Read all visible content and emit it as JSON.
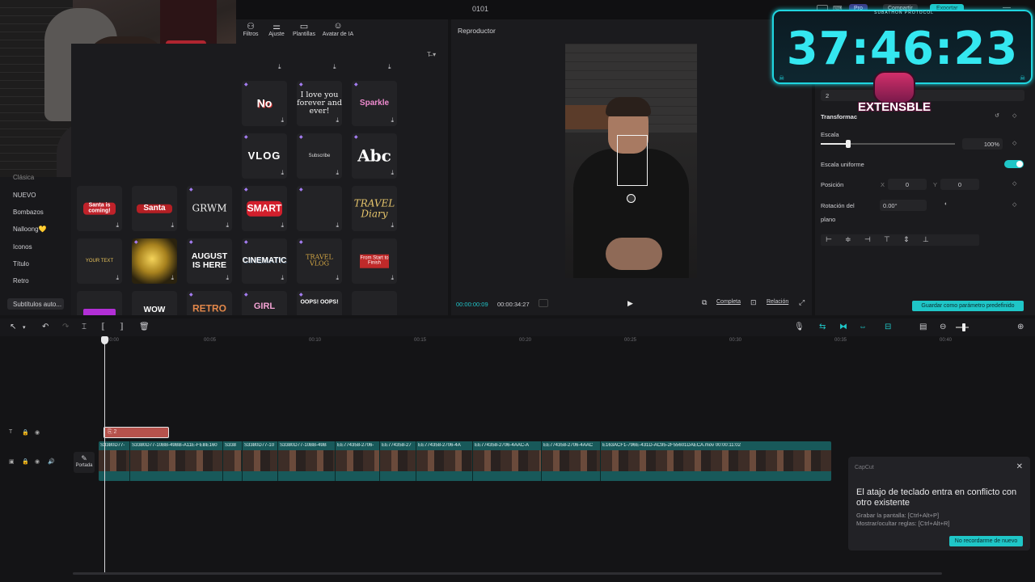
{
  "window": {
    "title": "0101"
  },
  "media_tabs": [
    {
      "label": "Filtros",
      "icon": "filter-icon"
    },
    {
      "label": "Ajuste",
      "icon": "sliders-icon"
    },
    {
      "label": "Plantillas",
      "icon": "template-icon"
    },
    {
      "label": "Avatar de IA",
      "icon": "avatar-icon"
    }
  ],
  "categories": [
    {
      "label": "Clásica"
    },
    {
      "label": "NUEVO"
    },
    {
      "label": "Bombazos"
    },
    {
      "label": "Nalloong💛"
    },
    {
      "label": "Iconos"
    },
    {
      "label": "Título"
    },
    {
      "label": "Retro"
    },
    {
      "label": "Subtítulos auto..."
    }
  ],
  "stickers": {
    "row1": [
      "No",
      "I love you forever and ever!",
      "Sparkle"
    ],
    "row2": [
      "VLOG",
      "Subscribe",
      "Abc"
    ],
    "row3": [
      "Santa is coming!",
      "Santa",
      "GRWM",
      "SMART",
      "",
      "TRAVEL Diary"
    ],
    "row4": [
      "YOUR TEXT",
      "",
      "AUGUST IS HERE",
      "CINEMATIC",
      "TRAVEL VLOG",
      "From Start to Finish"
    ],
    "row5": [
      "",
      "WOW",
      "RETRO",
      "GIRL",
      "OOPS! OOPS!",
      ""
    ]
  },
  "player": {
    "title": "Reproductor",
    "current_time": "00:00:00:09",
    "total_time": "00:00:34:27",
    "full_label": "Completa",
    "ratio_label": "Relación"
  },
  "props": {
    "top_value": "2",
    "transform_label": "Transformac",
    "scale_label": "Escala",
    "scale_value": "100%",
    "scale_fraction": 0.2,
    "uniform_scale_label": "Escala uniforme",
    "uniform_scale_on": true,
    "position_label": "Posición",
    "pos_x_axis": "X",
    "pos_x": "0",
    "pos_y_axis": "Y",
    "pos_y": "0",
    "rotation_label_1": "Rotación del",
    "rotation_label_2": "plano",
    "rotation_value": "0.00°",
    "save_button": "Guardar como parámetro predefinido"
  },
  "top_header": {
    "pro_label": "Pro",
    "share_label": "Compartir",
    "export_label": "Exportar"
  },
  "timer": {
    "subtitle": "SUBATHON PROTOCOL",
    "value": "37:46:23",
    "badge": "EXTENSBLE"
  },
  "timeline": {
    "ruler": [
      "00:00",
      "00:05",
      "00:10",
      "00:15",
      "00:20",
      "00:25",
      "00:30",
      "00:35",
      "00:40"
    ],
    "text_clip": "2",
    "portada_label": "Portada",
    "clips": [
      "S3380D77-",
      "S3380D77-10BB-49BB-A11E-FEBE160",
      "S338",
      "S3380D77-10",
      "S3380D77-10BB-49B",
      "EE774358-2706-",
      "EE774358-27",
      "EE774358-2706-4A",
      "EE774358-2706-4AAC-A",
      "EE774358-2706-4AAC",
      "E163ACF1-796E-431D-AC95-2F55601DAECA.mov  00:00:11:02"
    ]
  },
  "popup": {
    "brand": "CapCut",
    "heading": "El atajo de teclado entra en conflicto con otro existente",
    "line1": "Grabar la pantalla: [Ctrl+Alt+P]",
    "line2": "Mostrar/ocultar reglas: [Ctrl+Alt+R]",
    "button": "No recordarme de nuevo"
  },
  "colors": {
    "accent": "#1fc6c7",
    "text_clip": "#b5524c",
    "video_track": "#18595a",
    "timer": "#34e7f0"
  }
}
